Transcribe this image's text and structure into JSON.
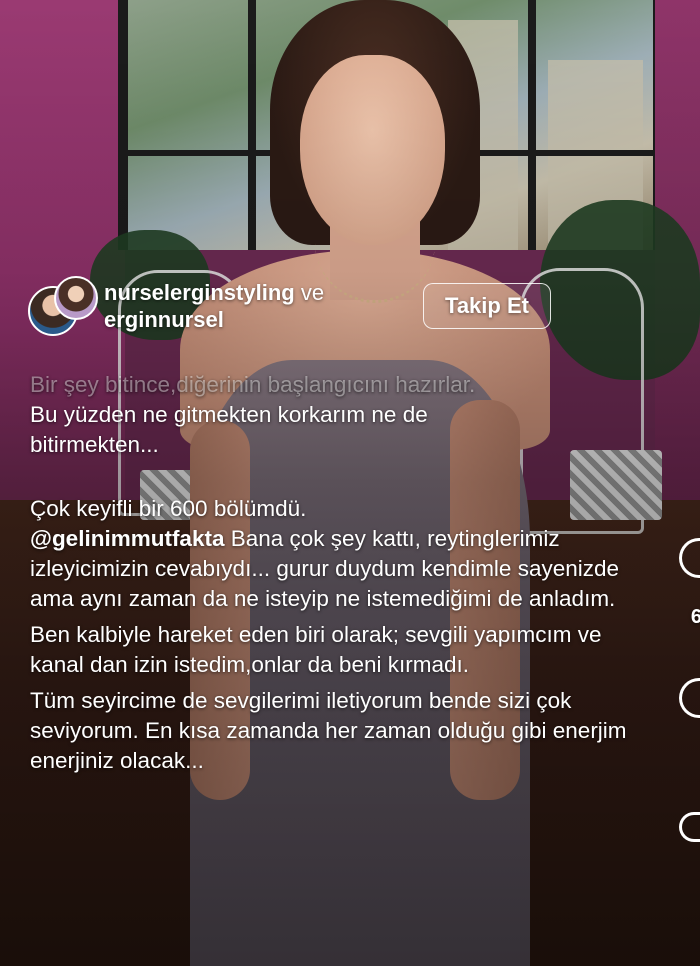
{
  "post": {
    "author_primary": "nurselerginstyling",
    "author_joiner": "ve",
    "author_secondary": "erginnursel",
    "follow_label": "Takip Et"
  },
  "caption": {
    "faded_line": "Bir şey bitince,diğerinin başlangıcını hazırlar.",
    "line_1": "Bu yüzden ne gitmekten korkarım ne de",
    "line_2": "bitirmekten...",
    "para_1_text": "Çok keyifli bir 600 bölümdü.",
    "mention": "@gelinimmutfakta",
    "para_2_text": " Bana çok şey kattı, reytinglerimiz izleyicimizin cevabıydı... gurur duydum kendimle sayenizde ama aynı zaman da ne isteyip ne istemediğimi de anladım.",
    "para_3_text": "Ben kalbiyle hareket eden biri olarak; sevgili yapımcım ve kanal dan izin istedim,onlar da beni kırmadı.",
    "para_4_text": "Tüm seyircime de sevgilerimi iletiyorum bende sizi çok seviyorum. En kısa zamanda her zaman olduğu gibi enerjim enerjiniz olacak..."
  },
  "side_actions": {
    "count_fragment": "6"
  }
}
